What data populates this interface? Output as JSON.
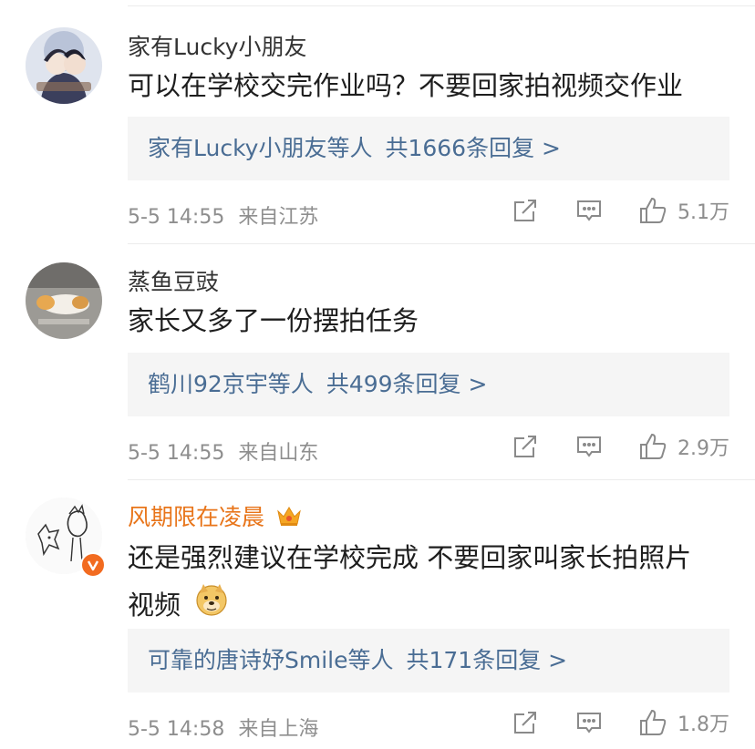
{
  "comments": [
    {
      "username": "家有Lucky小朋友",
      "text": "可以在学校交完作业吗？不要回家拍视频交作业",
      "reply_names": "家有Lucky小朋友等人",
      "reply_count": "共1666条回复 >",
      "time": "5-5 14:55",
      "location": "来自江苏",
      "likes": "5.1万",
      "avatar": "anime-avatar"
    },
    {
      "username": "蒸鱼豆豉",
      "text": "家长又多了一份摆拍任务",
      "reply_names": "鹤川92京宇等人",
      "reply_count": "共499条回复 >",
      "time": "5-5 14:55",
      "location": "来自山东",
      "likes": "2.9万",
      "avatar": "cat-photo-avatar"
    },
    {
      "username": "风期限在凌晨",
      "text_line1": "还是强烈建议在学校完成 不要回家叫家长拍照片",
      "text_line2": "视频",
      "reply_names": "可靠的唐诗妤Smile等人",
      "reply_count": "共171条回复 >",
      "time": "5-5 14:58",
      "location": "来自上海",
      "likes": "1.8万",
      "avatar": "sketch-avatar",
      "badge": "crown-icon",
      "verified": "V",
      "emoji": "doge-emoji"
    }
  ],
  "colors": {
    "username": "#333333",
    "vip_username": "#e8751a",
    "link": "#4a6d94",
    "meta": "#8e8e8e",
    "reply_bg": "#f5f5f5",
    "verified": "#f26b20"
  }
}
